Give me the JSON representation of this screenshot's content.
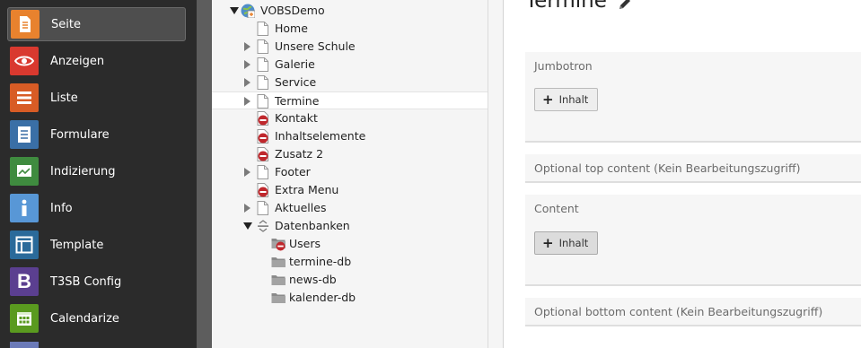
{
  "modules": [
    {
      "label": "Seite",
      "icon": "page-icon",
      "color": "#e8822e",
      "active": true
    },
    {
      "label": "Anzeigen",
      "icon": "eye-icon",
      "color": "#d9392f",
      "active": false
    },
    {
      "label": "Liste",
      "icon": "list-icon",
      "color": "#d85c25",
      "active": false
    },
    {
      "label": "Formulare",
      "icon": "form-icon",
      "color": "#3a6fa6",
      "active": false
    },
    {
      "label": "Indizierung",
      "icon": "indexing-icon",
      "color": "#3f8b3f",
      "active": false
    },
    {
      "label": "Info",
      "icon": "info-icon",
      "color": "#5897d6",
      "active": false
    },
    {
      "label": "Template",
      "icon": "template-icon",
      "color": "#2a6a9a",
      "active": false
    },
    {
      "label": "T3SB Config",
      "icon": "bootstrap-icon",
      "color": "#5b3f90",
      "active": false
    },
    {
      "label": "Calendarize",
      "icon": "calendar-icon",
      "color": "#5a9a1f",
      "active": false
    }
  ],
  "tree": {
    "root": "VOBSDemo",
    "pages": [
      {
        "label": "Home",
        "type": "page",
        "toggle": "none",
        "level": 1
      },
      {
        "label": "Unsere Schule",
        "type": "page",
        "toggle": "closed",
        "level": 1
      },
      {
        "label": "Galerie",
        "type": "page",
        "toggle": "closed",
        "level": 1
      },
      {
        "label": "Service",
        "type": "page",
        "toggle": "closed",
        "level": 1
      },
      {
        "label": "Termine",
        "type": "page",
        "toggle": "closed",
        "level": 1,
        "selected": true
      },
      {
        "label": "Kontakt",
        "type": "hidden",
        "toggle": "none",
        "level": 1
      },
      {
        "label": "Inhaltselemente",
        "type": "hidden",
        "toggle": "none",
        "level": 1
      },
      {
        "label": "Zusatz 2",
        "type": "hidden",
        "toggle": "none",
        "level": 1
      },
      {
        "label": "Footer",
        "type": "page",
        "toggle": "closed",
        "level": 1
      },
      {
        "label": "Extra Menu",
        "type": "hidden",
        "toggle": "none",
        "level": 1
      },
      {
        "label": "Aktuelles",
        "type": "page",
        "toggle": "closed",
        "level": 1
      },
      {
        "label": "Datenbanken",
        "type": "separator",
        "toggle": "open",
        "level": 1
      },
      {
        "label": "Users",
        "type": "folder-hidden",
        "toggle": "none",
        "level": 2
      },
      {
        "label": "termine-db",
        "type": "folder",
        "toggle": "none",
        "level": 2
      },
      {
        "label": "news-db",
        "type": "folder",
        "toggle": "none",
        "level": 2
      },
      {
        "label": "kalender-db",
        "type": "folder",
        "toggle": "none",
        "level": 2
      }
    ]
  },
  "main": {
    "page_title": "Termine",
    "columns": [
      {
        "title": "Jumbotron",
        "button": "Inhalt",
        "button_pressed": false
      },
      {
        "title": "Optional top content (Kein Bearbeitungszugriff)"
      },
      {
        "title": "Content",
        "button": "Inhalt",
        "button_pressed": true
      },
      {
        "title": "Optional bottom content (Kein Bearbeitungszugriff)"
      }
    ]
  }
}
